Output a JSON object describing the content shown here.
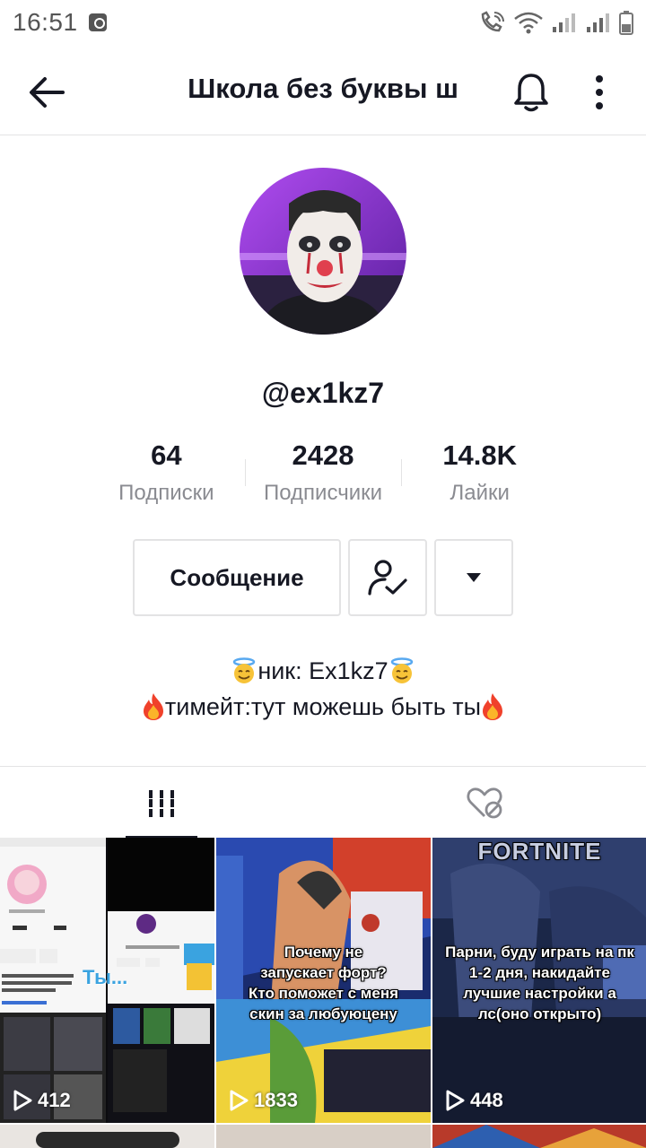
{
  "status_bar": {
    "time": "16:51"
  },
  "header": {
    "title": "Школа без буквы ш"
  },
  "profile": {
    "username": "@ex1kz7",
    "stats": [
      {
        "value": "64",
        "label": "Подписки"
      },
      {
        "value": "2428",
        "label": "Подписчики"
      },
      {
        "value": "14.8K",
        "label": "Лайки"
      }
    ],
    "message_button": "Сообщение",
    "bio_line1": "ник: Ex1kz7",
    "bio_line2": "тимейт:тут можешь быть ты"
  },
  "videos": [
    {
      "views": "412",
      "overlay": "Ты..."
    },
    {
      "views": "1833",
      "caption": "Почему не запускает форт? Кто поможет с меня скин за любуюцену"
    },
    {
      "views": "448",
      "caption": "Парни, буду играть на пк 1-2 дня, накидайте лучшие настройки а лс(оно открыто)",
      "banner": "FORTNITE"
    }
  ],
  "colors": {
    "text_primary": "#161823",
    "text_secondary": "#8a8b91",
    "divider": "#e3e3e4"
  }
}
